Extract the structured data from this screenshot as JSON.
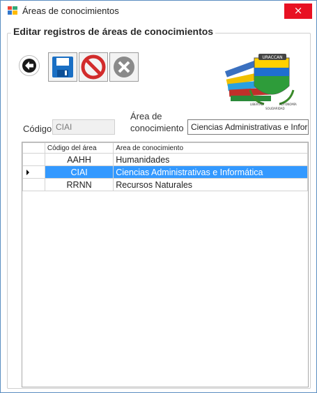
{
  "window": {
    "title": "Áreas de conocimientos",
    "close_label": "×"
  },
  "group": {
    "title": "Editar registros de áreas de conocimientos"
  },
  "toolbar": {
    "icons": [
      "back-arrow-icon",
      "save-icon",
      "cancel-icon",
      "delete-icon"
    ]
  },
  "logo": {
    "banner_text": "URACCAN",
    "left_motto": "LIBERTAD",
    "right_motto": "AUTONOMÍA",
    "bottom_motto": "SOLIDARIDAD"
  },
  "form": {
    "codigo_label": "Código",
    "codigo_value": "CIAI",
    "area_label_line1": "Área de",
    "area_label_line2": "conocimiento",
    "area_value": "Ciencias Administrativas e Informática"
  },
  "grid": {
    "columns": [
      "Código del área",
      "Area de conocimiento"
    ],
    "rows": [
      {
        "codigo": "AAHH",
        "area": "Humanidades",
        "selected": false
      },
      {
        "codigo": "CIAI",
        "area": "Ciencias Administrativas e Informática",
        "selected": true
      },
      {
        "codigo": "RRNN",
        "area": "Recursos Naturales",
        "selected": false
      }
    ]
  },
  "colors": {
    "selection": "#3399ff",
    "close": "#e81123",
    "save": "#1a6fc4",
    "cancel": "#d22b2b",
    "delete": "#8a8a8a"
  }
}
